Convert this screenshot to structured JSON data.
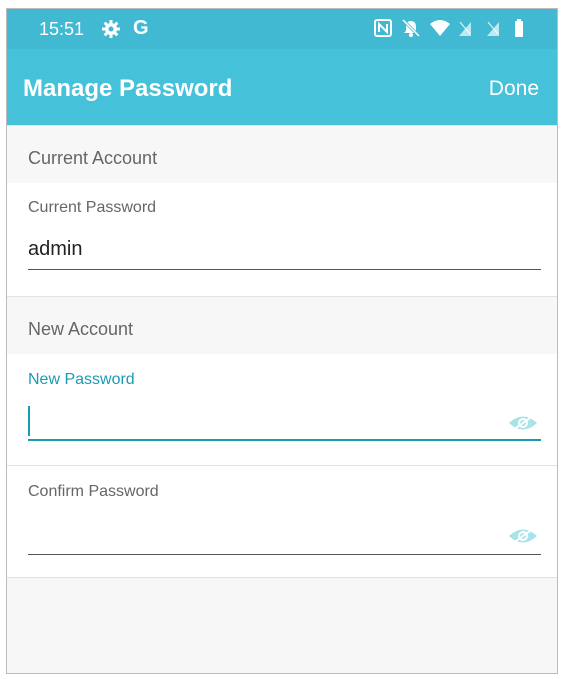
{
  "status_bar": {
    "time": "15:51",
    "left_icons": [
      "gear-icon",
      "google-icon"
    ],
    "google_letter": "G",
    "right_icons": [
      "nfc-icon",
      "bell-off-icon",
      "wifi-icon",
      "signal-1-icon",
      "signal-2-icon",
      "battery-icon"
    ]
  },
  "app_bar": {
    "title": "Manage Password",
    "done_label": "Done"
  },
  "sections": {
    "current": {
      "header": "Current Account",
      "password_label": "Current Password",
      "password_value": "admin"
    },
    "new": {
      "header": "New Account",
      "new_password_label": "New Password",
      "new_password_value": "",
      "confirm_password_label": "Confirm Password",
      "confirm_password_value": ""
    }
  },
  "colors": {
    "status_bar": "#41b9d2",
    "app_bar": "#45c1da",
    "accent": "#1a9bb4",
    "eye_icon": "#a8e2ea"
  }
}
